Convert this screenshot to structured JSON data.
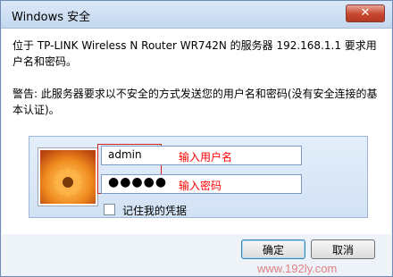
{
  "window": {
    "title": "Windows 安全"
  },
  "message": {
    "line1": "位于 TP-LINK Wireless N Router WR742N 的服务器 192.168.1.1 要求用户名和密码。",
    "line2": "警告: 此服务器要求以不安全的方式发送您的用户名和密码(没有安全连接的基本认证)。"
  },
  "credentials": {
    "username": {
      "value": "admin",
      "annotation": "输入用户名"
    },
    "password": {
      "masked": "●●●●●",
      "annotation": "输入密码"
    },
    "remember_label": "记住我的凭据",
    "remember_checked": false
  },
  "buttons": {
    "ok": "确定",
    "cancel": "取消"
  },
  "watermark": "www.192ly.com",
  "colors": {
    "annotation": "#ff0000",
    "watermark": "#e08080",
    "close_button": "#c6462f"
  }
}
